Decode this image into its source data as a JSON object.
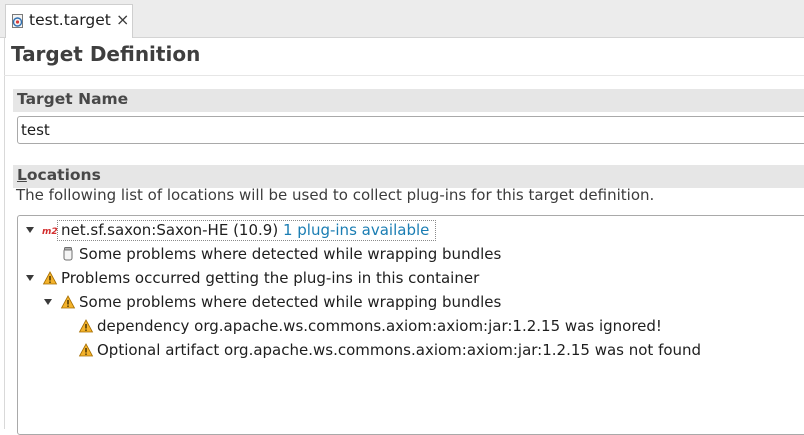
{
  "tab": {
    "title": "test.target",
    "icon": "target-file-icon",
    "close": "×"
  },
  "page_title": "Target Definition",
  "target_name": {
    "label": "Target Name",
    "value": "test"
  },
  "locations": {
    "label": "Locations",
    "description": "The following list of locations will be used to collect plug-ins for this target definition.",
    "tree": [
      {
        "text": "net.sf.saxon:Saxon-HE (10.9)",
        "link": "1 plug-ins available",
        "icon": "maven-m2-icon",
        "expanded": true,
        "level": 0
      },
      {
        "text": "Some problems where detected while wrapping bundles",
        "icon": "jar-icon",
        "level": 1
      },
      {
        "text": "Problems occurred getting the plug-ins in this container",
        "icon": "warning-icon",
        "expanded": true,
        "level": 0
      },
      {
        "text": "Some problems where detected while wrapping bundles",
        "icon": "warning-icon",
        "expanded": true,
        "level": 1
      },
      {
        "text": "dependency org.apache.ws.commons.axiom:axiom:jar:1.2.15 was ignored!",
        "icon": "warning-icon",
        "level": 2
      },
      {
        "text": "Optional artifact org.apache.ws.commons.axiom:axiom:jar:1.2.15 was not found",
        "icon": "warning-icon",
        "level": 2
      }
    ]
  },
  "colors": {
    "warning": "#e8a317",
    "link": "#1a7db3",
    "maven": "#d32f2f"
  }
}
